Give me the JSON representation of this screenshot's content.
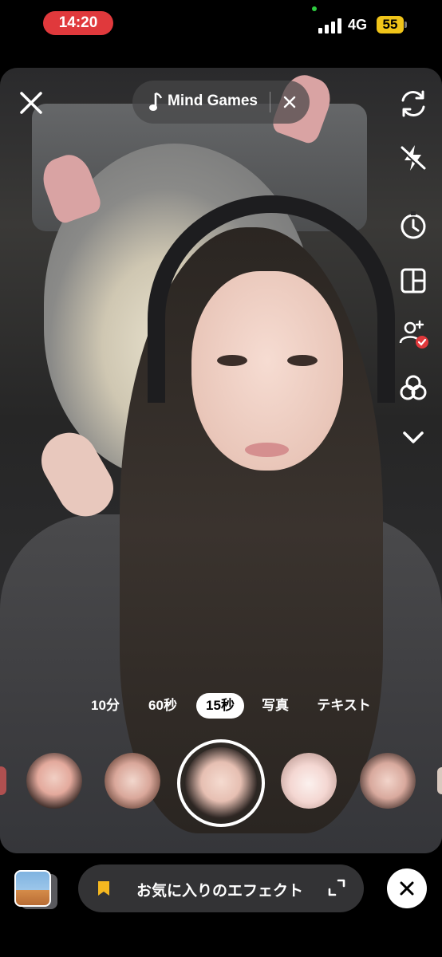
{
  "status_bar": {
    "time": "14:20",
    "network": "4G",
    "battery": "55"
  },
  "header": {
    "music_title": "Mind Games"
  },
  "side_toolbar": {
    "icons": [
      "flip-camera-icon",
      "flash-off-icon",
      "timer-icon",
      "layout-icon",
      "duet-icon",
      "beauty-icon",
      "chevron-down-icon"
    ]
  },
  "mode_tabs": [
    {
      "label": "10分",
      "active": false
    },
    {
      "label": "60秒",
      "active": false
    },
    {
      "label": "15秒",
      "active": true
    },
    {
      "label": "写真",
      "active": false
    },
    {
      "label": "テキスト",
      "active": false
    }
  ],
  "effects": [
    "effect-stickers",
    "effect-cat-whiskers",
    "effect-selected",
    "effect-cat-face",
    "effect-soft"
  ],
  "bottom_bar": {
    "favorites_label": "お気に入りのエフェクト"
  },
  "colors": {
    "time_pill": "#e0393c",
    "battery": "#f0c419",
    "bookmark": "#f5b820",
    "badge": "#e0393c"
  }
}
